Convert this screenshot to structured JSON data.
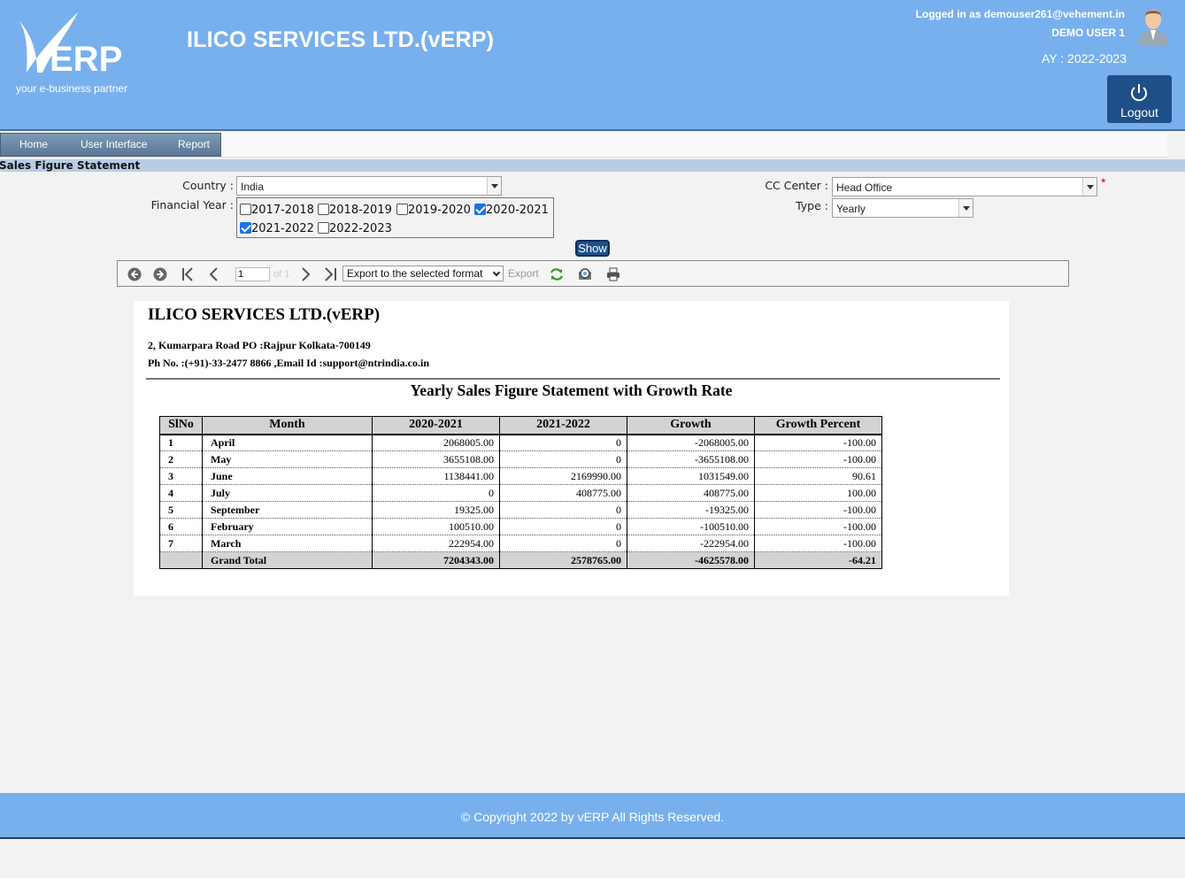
{
  "header": {
    "logo_text": "ERP",
    "logo_tagline": "your e-business partner",
    "app_title": "ILICO SERVICES LTD.(vERP)",
    "logged_in": "Logged in as demouser261@vehement.in",
    "user_name": "DEMO USER 1",
    "academic_year": "AY : 2022-2023",
    "logout_label": "Logout"
  },
  "menu": {
    "items": [
      {
        "label": "Home"
      },
      {
        "label": "User Interface"
      },
      {
        "label": "Report"
      }
    ]
  },
  "section_title": "Sales Figure Statement",
  "filters": {
    "country_label": "Country :",
    "country_value": "India",
    "financial_year_label": "Financial Year :",
    "financial_years": [
      {
        "label": "2017-2018",
        "checked": false
      },
      {
        "label": "2018-2019",
        "checked": false
      },
      {
        "label": "2019-2020",
        "checked": false
      },
      {
        "label": "2020-2021",
        "checked": true
      },
      {
        "label": "2021-2022",
        "checked": true
      },
      {
        "label": "2022-2023",
        "checked": false
      }
    ],
    "cc_center_label": "CC Center :",
    "cc_center_value": "Head Office",
    "type_label": "Type :",
    "type_value": "Yearly",
    "required_mark": "*",
    "show_label": "Show"
  },
  "toolbar": {
    "page_number": "1",
    "page_of": "of 1",
    "export_format": "Export to the selected format",
    "export_label": "Export"
  },
  "report": {
    "company": "ILICO SERVICES LTD.(vERP)",
    "address": "2, Kumarpara Road PO :Rajpur Kolkata-700149",
    "phone": "Ph No. :(+91)-33-2477 8866 ,Email Id :support@ntrindia.co.in",
    "title": "Yearly Sales Figure Statement with Growth Rate",
    "columns": [
      "SlNo",
      "Month",
      "2020-2021",
      "2021-2022",
      "Growth",
      "Growth Percent"
    ],
    "rows": [
      [
        "1",
        "April",
        "2068005.00",
        "0",
        "-2068005.00",
        "-100.00"
      ],
      [
        "2",
        "May",
        "3655108.00",
        "0",
        "-3655108.00",
        "-100.00"
      ],
      [
        "3",
        "June",
        "1138441.00",
        "2169990.00",
        "1031549.00",
        "90.61"
      ],
      [
        "4",
        "July",
        "0",
        "408775.00",
        "408775.00",
        "100.00"
      ],
      [
        "5",
        "September",
        "19325.00",
        "0",
        "-19325.00",
        "-100.00"
      ],
      [
        "6",
        "February",
        "100510.00",
        "0",
        "-100510.00",
        "-100.00"
      ],
      [
        "7",
        "March",
        "222954.00",
        "0",
        "-222954.00",
        "-100.00"
      ]
    ],
    "total": [
      "",
      "Grand Total",
      "7204343.00",
      "2578765.00",
      "-4625578.00",
      "-64.21"
    ]
  },
  "footer": {
    "copyright": "© Copyright 2022 by vERP All Rights Reserved."
  },
  "colors": {
    "header_bg": "#78b0ee",
    "button_dark": "#1f4f89"
  }
}
